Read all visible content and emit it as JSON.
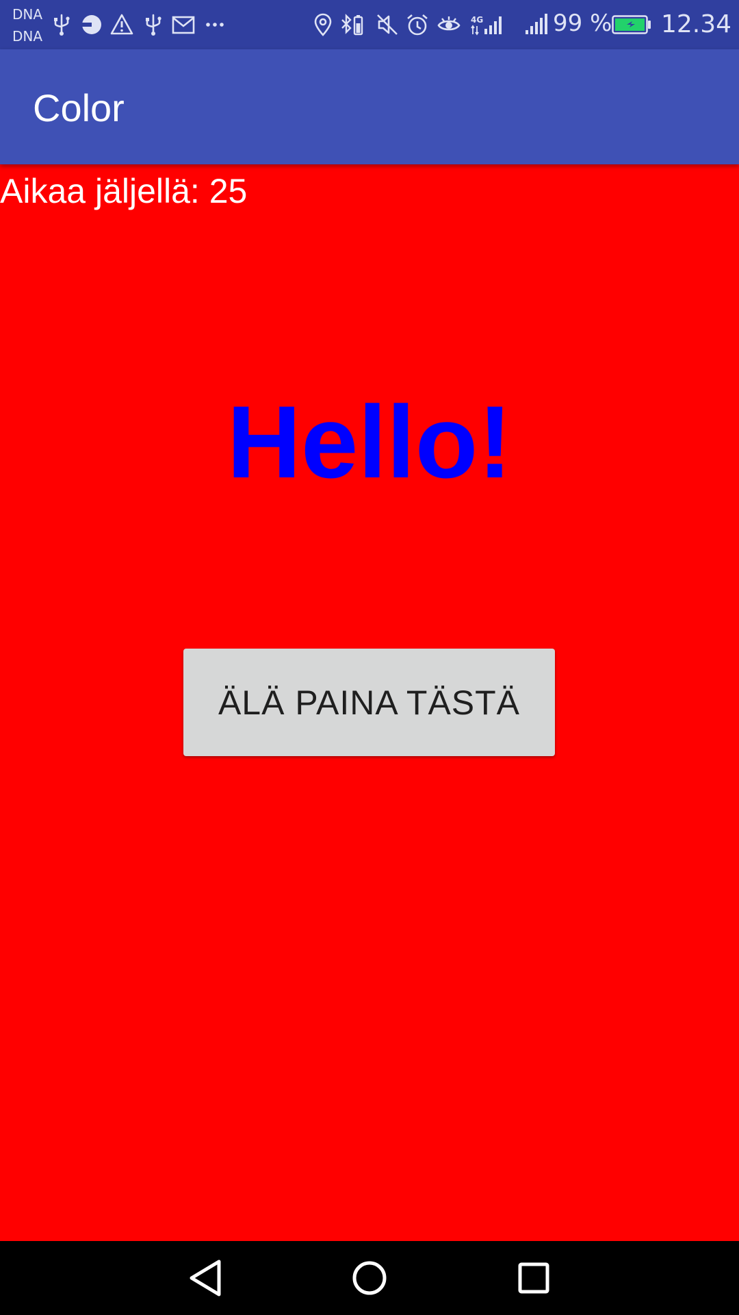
{
  "status_bar": {
    "carrier_1": "DNA",
    "carrier_2": "DNA",
    "battery_percent": "99 %",
    "time": "12.34",
    "background_color": "#303f9f",
    "icons_left": [
      "usb-icon",
      "data-saver-icon",
      "warning-icon",
      "usb-icon",
      "gmail-icon",
      "more-icon"
    ],
    "icons_right": [
      "location-icon",
      "bluetooth-battery-icon",
      "muted-icon",
      "alarm-icon",
      "eye-comfort-icon",
      "4g-signal-icon",
      "signal-icon",
      "battery-charging-icon"
    ]
  },
  "toolbar": {
    "title": "Color",
    "background_color": "#3f51b5"
  },
  "content": {
    "background_color": "#ff0000",
    "timer_text": "Aikaa jäljellä: 25",
    "hello_text": "Hello!",
    "hello_color": "#0000ff",
    "button_label": "ÄLÄ PAINA TÄSTÄ"
  },
  "nav_bar": {
    "buttons": [
      "back-icon",
      "home-icon",
      "recents-icon"
    ]
  }
}
